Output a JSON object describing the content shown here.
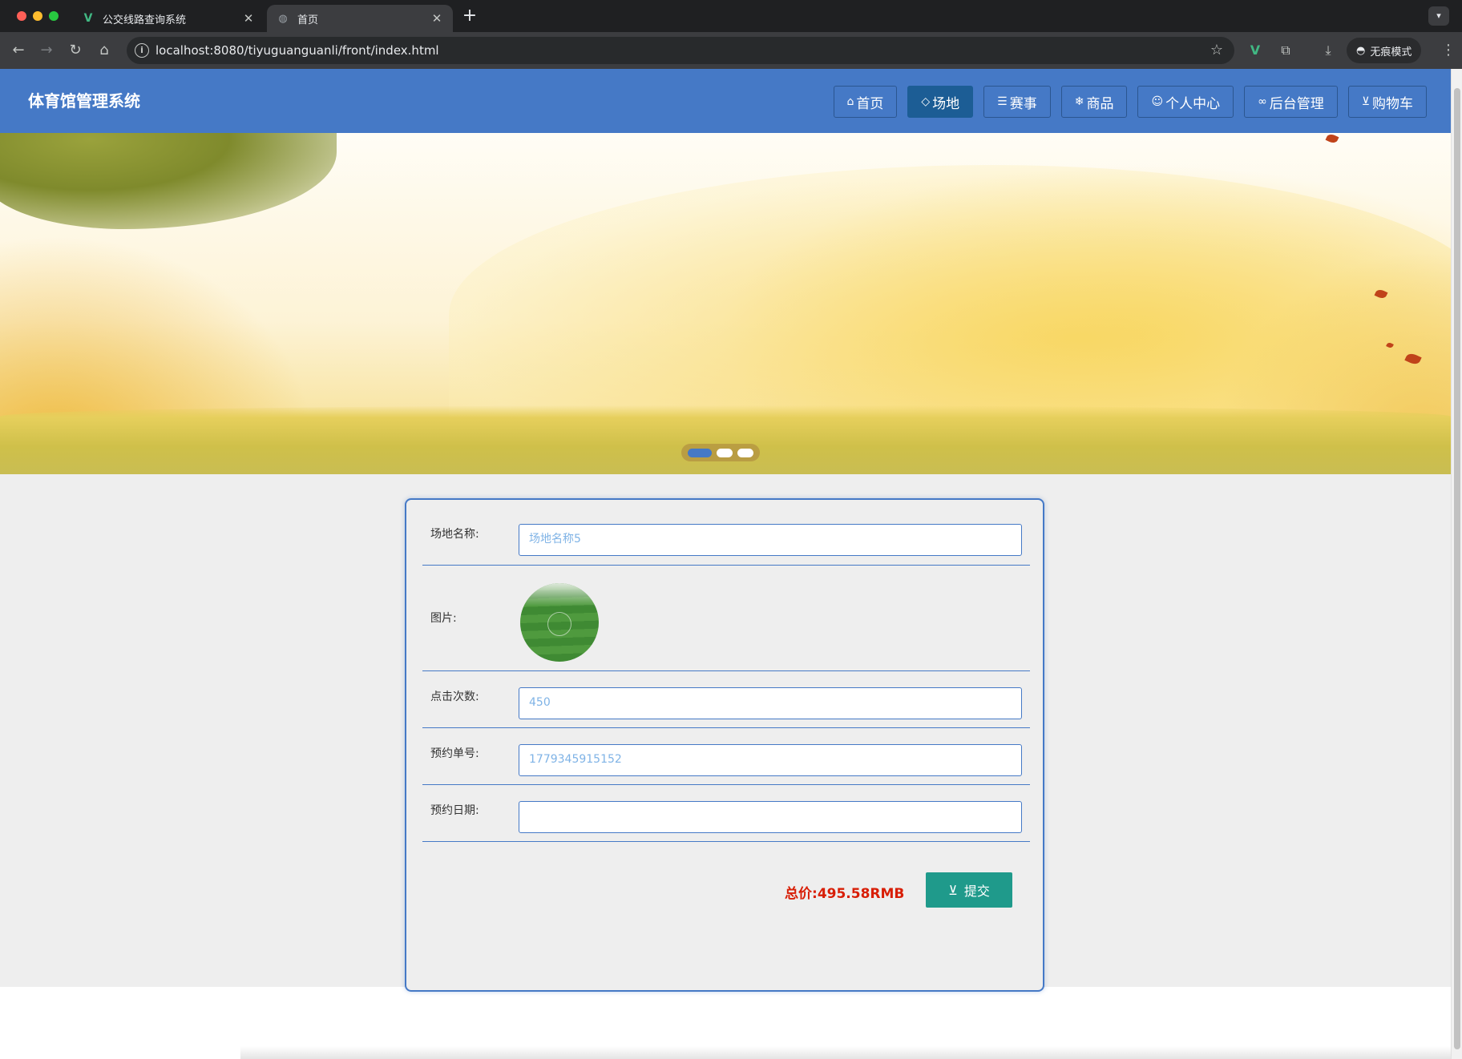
{
  "browser": {
    "tabs": [
      {
        "title": "公交线路查询系统",
        "favicon": "vue-logo-icon"
      },
      {
        "title": "首页",
        "favicon": "globe-icon"
      }
    ],
    "url": "localhost:8080/tiyuguanguanli/front/index.html",
    "incognito_label": "无痕模式"
  },
  "site": {
    "title": "体育馆管理系统",
    "nav": [
      {
        "label": "首页",
        "icon": "home-icon"
      },
      {
        "label": "场地",
        "icon": "tag-icon",
        "active": true
      },
      {
        "label": "赛事",
        "icon": "sliders-icon"
      },
      {
        "label": "商品",
        "icon": "snowflake-icon"
      },
      {
        "label": "个人中心",
        "icon": "user-icon"
      },
      {
        "label": "后台管理",
        "icon": "link-icon"
      },
      {
        "label": "购物车",
        "icon": "cart-icon"
      }
    ],
    "accent_color": "#4579c6"
  },
  "banner": {
    "slide_count": 3,
    "active_slide": 1
  },
  "form": {
    "name_label": "场地名称:",
    "name_value": "场地名称5",
    "image_label": "图片:",
    "clicks_label": "点击次数:",
    "clicks_value": "450",
    "order_label": "预约单号:",
    "order_value": "1779345915152",
    "date_label": "预约日期:",
    "date_value": "",
    "total_label": "总价:",
    "total_value": "495.58RMB",
    "submit_label": "提交"
  }
}
